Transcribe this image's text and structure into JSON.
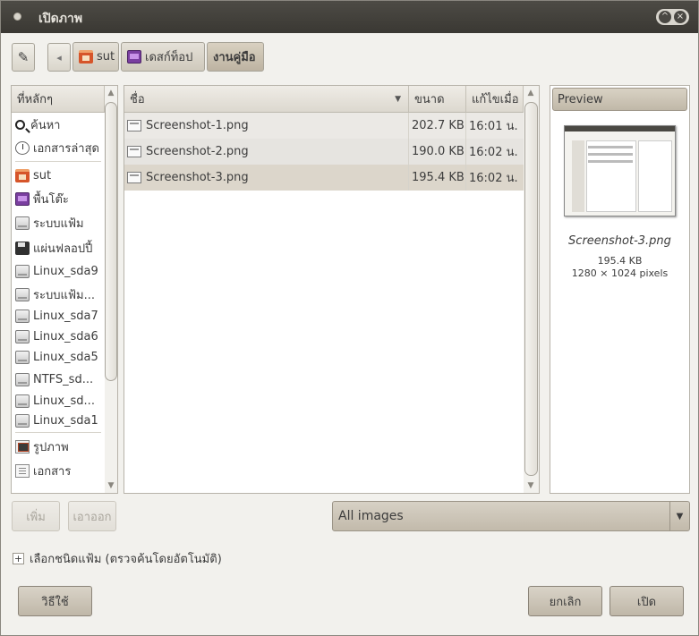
{
  "window": {
    "title": "เปิดภาพ"
  },
  "toolbar": {
    "edit_icon": "pencil-icon",
    "back_arrow": "◂"
  },
  "breadcrumbs": [
    {
      "label": "sut",
      "icon": "home-folder-icon"
    },
    {
      "label": "เดสก์ท็อป",
      "icon": "desktop-icon"
    },
    {
      "label": "งานคู่มือ",
      "active": true
    }
  ],
  "places": {
    "header": "ที่หลักๆ",
    "items": [
      {
        "label": "ค้นหา",
        "icon": "search-icon"
      },
      {
        "label": "เอกสารล่าสุด",
        "icon": "recent-icon"
      },
      {
        "label": "sut",
        "icon": "home-folder-icon"
      },
      {
        "label": "พื้นโต๊ะ",
        "icon": "desktop-icon"
      },
      {
        "label": "ระบบแฟ้ม",
        "icon": "drive-icon"
      },
      {
        "label": "แผ่นฟลอปปี้",
        "icon": "floppy-icon"
      },
      {
        "label": "Linux_sda9",
        "icon": "drive-icon"
      },
      {
        "label": "ระบบแฟ้ม...",
        "icon": "drive-icon"
      },
      {
        "label": "Linux_sda7",
        "icon": "drive-icon"
      },
      {
        "label": "Linux_sda6",
        "icon": "drive-icon"
      },
      {
        "label": "Linux_sda5",
        "icon": "drive-icon"
      },
      {
        "label": "NTFS_sd...",
        "icon": "drive-icon"
      },
      {
        "label": "Linux_sd...",
        "icon": "drive-icon"
      },
      {
        "label": "Linux_sda1",
        "icon": "drive-icon"
      },
      {
        "label": "รูปภาพ",
        "icon": "pictures-icon"
      },
      {
        "label": "เอกสาร",
        "icon": "documents-icon"
      }
    ],
    "add_label": "เพิ่ม",
    "remove_label": "เอาออก"
  },
  "files": {
    "columns": {
      "name": "ชื่อ",
      "size": "ขนาด",
      "modified": "แก้ไขเมื่อ"
    },
    "rows": [
      {
        "name": "Screenshot-1.png",
        "size": "202.7 KB",
        "modified": "16:01 น."
      },
      {
        "name": "Screenshot-2.png",
        "size": "190.0 KB",
        "modified": "16:02 น."
      },
      {
        "name": "Screenshot-3.png",
        "size": "195.4 KB",
        "modified": "16:02 น.",
        "selected": true
      }
    ]
  },
  "preview": {
    "header": "Preview",
    "name": "Screenshot-3.png",
    "size": "195.4 KB",
    "dimensions": "1280 × 1024 pixels"
  },
  "filter": {
    "selected": "All images"
  },
  "expander": {
    "label": "เลือกชนิดแฟ้ม (ตรวจค้นโดยอัตโนมัติ)"
  },
  "buttons": {
    "help": "วิธีใช้",
    "cancel": "ยกเลิก",
    "open": "เปิด"
  }
}
